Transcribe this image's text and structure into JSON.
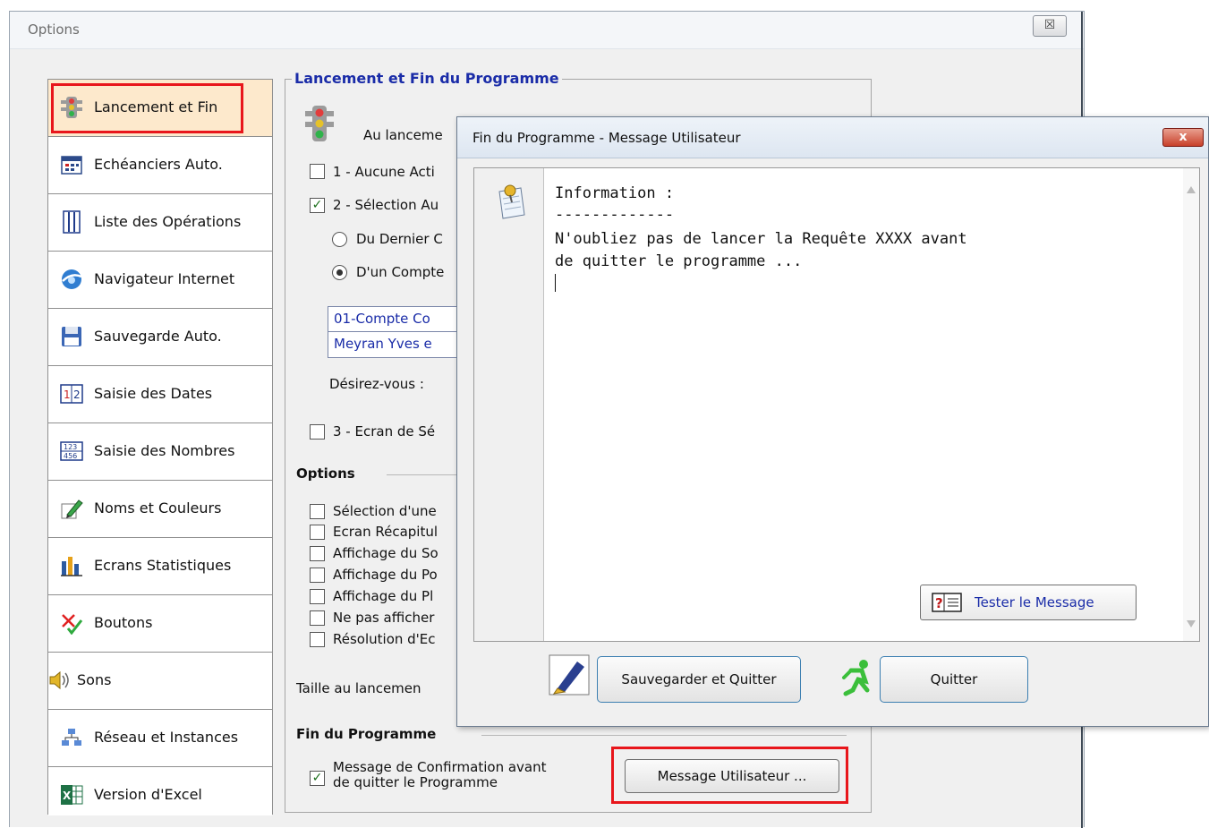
{
  "main_window": {
    "title": "Options",
    "close_label": "☒"
  },
  "sidebar": {
    "items": [
      {
        "label": "Lancement et Fin"
      },
      {
        "label": "Echéanciers Auto."
      },
      {
        "label": "Liste des Opérations"
      },
      {
        "label": "Navigateur Internet"
      },
      {
        "label": "Sauvegarde Auto."
      },
      {
        "label": "Saisie des Dates"
      },
      {
        "label": "Saisie des Nombres"
      },
      {
        "label": "Noms et Couleurs"
      },
      {
        "label": "Ecrans Statistiques"
      },
      {
        "label": "Boutons"
      },
      {
        "label": "Sons"
      },
      {
        "label": "Réseau et Instances"
      },
      {
        "label": "Version d'Excel"
      }
    ]
  },
  "panel": {
    "group_title": "Lancement et Fin du Programme",
    "launch_label": "Au lanceme",
    "opt1": "1 - Aucune Acti",
    "opt2": "2 - Sélection Au",
    "radio1": "Du Dernier C",
    "radio2": "D'un Compte",
    "account_rows": [
      "01-Compte Co",
      "Meyran Yves e"
    ],
    "desirez": "Désirez-vous :",
    "opt3": "3 - Ecran de Sé",
    "options_title": "Options",
    "options_items": [
      "Sélection d'une",
      "Ecran Récapitul",
      "Affichage du So",
      "Affichage du Po",
      "Affichage du Pl",
      "Ne pas afficher",
      "Résolution d'Ec"
    ],
    "taille_label": "Taille au lancemen",
    "fin_title": "Fin du Programme",
    "confirm_line1": "Message de Confirmation avant",
    "confirm_line2": "de quitter le Programme",
    "message_button": "Message Utilisateur ..."
  },
  "dialog": {
    "title": "Fin du Programme - Message Utilisateur",
    "close_label": "x",
    "msg_line1": "Information :",
    "msg_line2": "-------------",
    "msg_line3": "N'oubliez pas de lancer la Requête XXXX avant",
    "msg_line4": "de quitter le programme ...",
    "test_button": "Tester le Message",
    "save_button": "Sauvegarder et Quitter",
    "quit_button": "Quitter"
  },
  "colors": {
    "accent": "#1a2ca8",
    "highlight": "#e8161b",
    "selected_tab": "#fde9cc"
  }
}
